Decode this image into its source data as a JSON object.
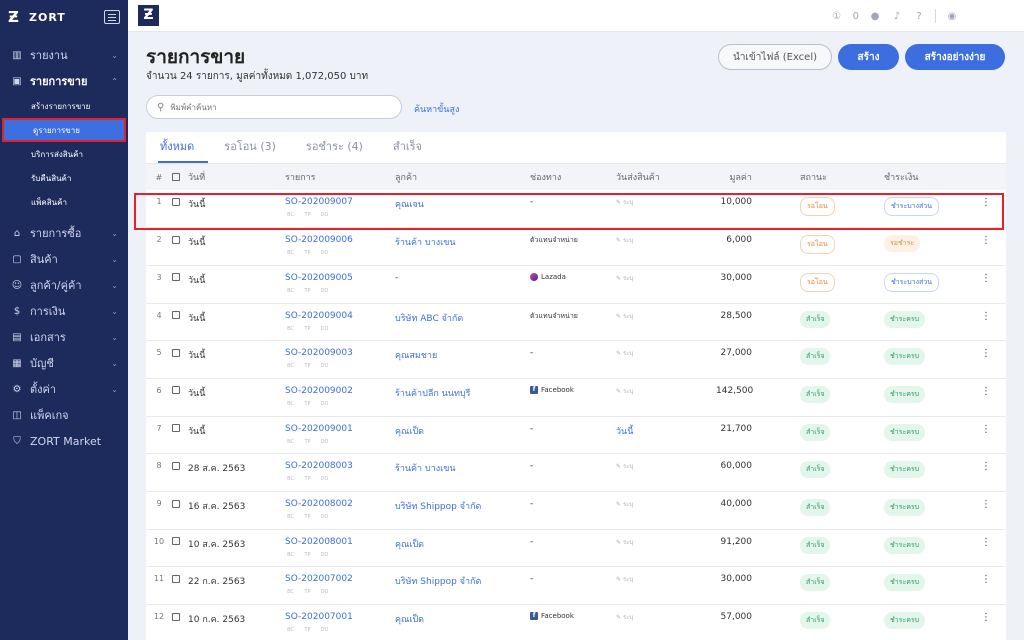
{
  "sidebar": {
    "brand": "ZORT",
    "items": [
      {
        "label": "รายงาน",
        "icon": "chart-icon"
      },
      {
        "label": "รายการขาย",
        "icon": "bag-icon"
      },
      {
        "label": "รายการซื้อ",
        "icon": "basket-icon"
      },
      {
        "label": "สินค้า",
        "icon": "box-icon"
      },
      {
        "label": "ลูกค้า/คู่ค้า",
        "icon": "people-icon"
      },
      {
        "label": "การเงิน",
        "icon": "money-icon"
      },
      {
        "label": "เอกสาร",
        "icon": "document-icon"
      },
      {
        "label": "บัญชี",
        "icon": "ledger-icon"
      },
      {
        "label": "ตั้งค่า",
        "icon": "gear-icon"
      },
      {
        "label": "แพ็คเกจ",
        "icon": "package-icon"
      },
      {
        "label": "ZORT Market",
        "icon": "market-icon"
      }
    ],
    "sub_items": [
      "สร้างรายการขาย",
      "ดูรายการขาย",
      "บริการส่งสินค้า",
      "รับคืนสินค้า",
      "แพ็คสินค้า"
    ]
  },
  "topbar": {
    "notif_count": "0"
  },
  "page": {
    "title": "รายการขาย",
    "subtitle": "จำนวน 24 รายการ, มูลค่าทั้งหมด 1,072,050 บาท",
    "btn_import": "นำเข้าไฟล์ (Excel)",
    "btn_create": "สร้าง",
    "btn_easy": "สร้างอย่างง่าย",
    "search_placeholder": "พิมพ์คำค้นหา",
    "advanced_search": "ค้นหาขั้นสูง"
  },
  "tabs": [
    "ทั้งหมด",
    "รอโอน (3)",
    "รอชำระ (4)",
    "สำเร็จ"
  ],
  "columns": [
    "#",
    "วันที่",
    "รายการ",
    "ลูกค้า",
    "ช่องทาง",
    "วันส่งสินค้า",
    "มูลค่า",
    "สถานะ",
    "ชำระเงิน"
  ],
  "ship_placeholder": "ระบุ",
  "mini_icons": [
    "BC",
    "TP",
    "DO"
  ],
  "rows": [
    {
      "idx": "1",
      "date": "วันนี้",
      "so": "SO-202009007",
      "customer": "คุณเจน",
      "channel": "-",
      "channel_icon": "",
      "ship": "",
      "amount": "10,000",
      "status": "รอโอน",
      "status_kind": "wait",
      "payment": "ชำระบางส่วน",
      "pay_kind": "partial"
    },
    {
      "idx": "2",
      "date": "วันนี้",
      "so": "SO-202009006",
      "customer": "ร้านค้า บางเขน",
      "channel": "ตัวแทนจำหน่าย",
      "channel_icon": "",
      "ship": "",
      "amount": "6,000",
      "status": "รอโอน",
      "status_kind": "wait",
      "payment": "รอชำระ",
      "pay_kind": "pay"
    },
    {
      "idx": "3",
      "date": "วันนี้",
      "so": "SO-202009005",
      "customer": "-",
      "channel": "Lazada",
      "channel_icon": "lazada",
      "ship": "",
      "amount": "30,000",
      "status": "รอโอน",
      "status_kind": "wait",
      "payment": "ชำระบางส่วน",
      "pay_kind": "partial"
    },
    {
      "idx": "4",
      "date": "วันนี้",
      "so": "SO-202009004",
      "customer": "บริษัท ABC จำกัด",
      "channel": "ตัวแทนจำหน่าย",
      "channel_icon": "",
      "ship": "",
      "amount": "28,500",
      "status": "สำเร็จ",
      "status_kind": "ok",
      "payment": "ชำระครบ",
      "pay_kind": "paid"
    },
    {
      "idx": "5",
      "date": "วันนี้",
      "so": "SO-202009003",
      "customer": "คุณสมชาย",
      "channel": "-",
      "channel_icon": "",
      "ship": "",
      "amount": "27,000",
      "status": "สำเร็จ",
      "status_kind": "ok",
      "payment": "ชำระครบ",
      "pay_kind": "paid"
    },
    {
      "idx": "6",
      "date": "วันนี้",
      "so": "SO-202009002",
      "customer": "ร้านค้าปลีก นนทบุรี",
      "channel": "Facebook",
      "channel_icon": "facebook",
      "ship": "",
      "amount": "142,500",
      "status": "สำเร็จ",
      "status_kind": "ok",
      "payment": "ชำระครบ",
      "pay_kind": "paid"
    },
    {
      "idx": "7",
      "date": "วันนี้",
      "so": "SO-202009001",
      "customer": "คุณเป็ด",
      "channel": "-",
      "channel_icon": "",
      "ship": "วันนี้",
      "amount": "21,700",
      "status": "สำเร็จ",
      "status_kind": "ok",
      "payment": "ชำระครบ",
      "pay_kind": "paid"
    },
    {
      "idx": "8",
      "date": "28 ส.ค. 2563",
      "so": "SO-202008003",
      "customer": "ร้านค้า บางเขน",
      "channel": "-",
      "channel_icon": "",
      "ship": "",
      "amount": "60,000",
      "status": "สำเร็จ",
      "status_kind": "ok",
      "payment": "ชำระครบ",
      "pay_kind": "paid"
    },
    {
      "idx": "9",
      "date": "16 ส.ค. 2563",
      "so": "SO-202008002",
      "customer": "บริษัท Shippop จำกัด",
      "channel": "-",
      "channel_icon": "",
      "ship": "",
      "amount": "40,000",
      "status": "สำเร็จ",
      "status_kind": "ok",
      "payment": "ชำระครบ",
      "pay_kind": "paid"
    },
    {
      "idx": "10",
      "date": "10 ส.ค. 2563",
      "so": "SO-202008001",
      "customer": "คุณเป็ด",
      "channel": "-",
      "channel_icon": "",
      "ship": "",
      "amount": "91,200",
      "status": "สำเร็จ",
      "status_kind": "ok",
      "payment": "ชำระครบ",
      "pay_kind": "paid"
    },
    {
      "idx": "11",
      "date": "22 ก.ค. 2563",
      "so": "SO-202007002",
      "customer": "บริษัท Shippop จำกัด",
      "channel": "-",
      "channel_icon": "",
      "ship": "",
      "amount": "30,000",
      "status": "สำเร็จ",
      "status_kind": "ok",
      "payment": "ชำระครบ",
      "pay_kind": "paid"
    },
    {
      "idx": "12",
      "date": "10 ก.ค. 2563",
      "so": "SO-202007001",
      "customer": "คุณเป็ด",
      "channel": "Facebook",
      "channel_icon": "facebook",
      "ship": "",
      "amount": "57,000",
      "status": "สำเร็จ",
      "status_kind": "ok",
      "payment": "ชำระครบ",
      "pay_kind": "paid"
    }
  ]
}
